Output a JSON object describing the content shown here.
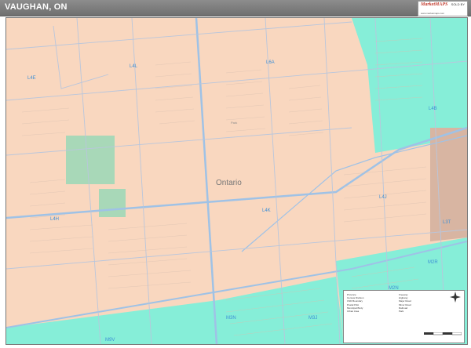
{
  "title": "VAUGHAN, ON",
  "logo": {
    "word": "MarketMAPS",
    "sub": "SOLD BY",
    "tag": "www.marketmaps.com"
  },
  "colors": {
    "land": "#f9d7bf",
    "zone_cyan": "#86eed8",
    "zone_brown": "#d8b5a2",
    "road": "#c0c8d8",
    "highway": "#9fc2e6",
    "green": "#a8d8b8",
    "label": "#3d8fd6"
  },
  "map": {
    "center_label": "Ontario",
    "postal_labels": [
      "L4L",
      "L6A",
      "L4J",
      "L4B",
      "L4H",
      "L4K",
      "L3T",
      "M3N",
      "M3J",
      "M2R",
      "M2N",
      "L4E",
      "M9V"
    ],
    "park_label": "Park"
  },
  "legend": {
    "column1": [
      "Province",
      "Census Division",
      "CSD Boundary",
      "Postal FSA",
      "Municipal Bndy",
      "Urban Area"
    ],
    "column2": [
      "Freeway",
      "Highway",
      "Major Road",
      "Minor Road",
      "Railroad",
      "Park"
    ]
  }
}
